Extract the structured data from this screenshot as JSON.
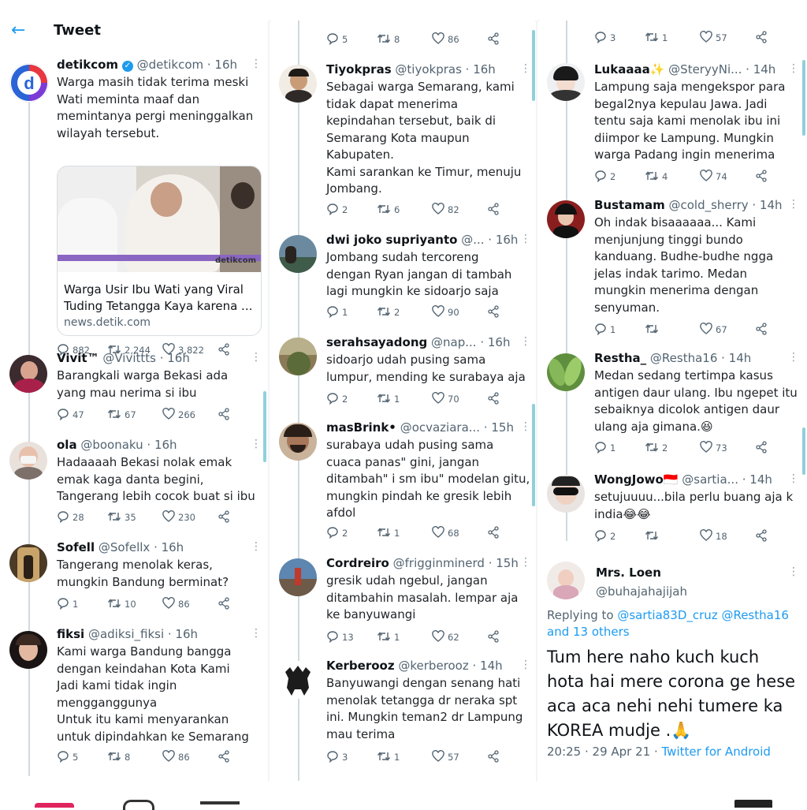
{
  "header": {
    "title": "Tweet"
  },
  "col1": {
    "main_tweet": {
      "name": "detikcom",
      "meta": "@detikcom · 16h",
      "text": "Warga masih tidak terima meski\nWati meminta maaf dan\nmemintanya pergi meninggalkan\nwilayah tersebut.",
      "card_title": "Warga Usir Ibu Wati yang Viral Tuding Tetangga Kaya karena ...",
      "card_domain": "news.detik.com",
      "card_watermark": "detikcom",
      "replies": "882",
      "retweets": "2,244",
      "likes": "3,822"
    },
    "tweets": [
      {
        "name": "Vivit™",
        "meta": "@Vivittts · 16h",
        "text": "Barangkali warga Bekasi ada\nyang mau nerima si ibu",
        "replies": "47",
        "retweets": "67",
        "likes": "266"
      },
      {
        "name": "ola",
        "meta": "@boonaku · 16h",
        "text": "Hadaaaah Bekasi nolak emak\nemak kaga danta begini,\nTangerang lebih cocok buat si ibu",
        "replies": "28",
        "retweets": "35",
        "likes": "230"
      },
      {
        "name": "Sofell",
        "meta": "@Sofellx · 16h",
        "text": "Tangerang menolak keras,\nmungkin Bandung berminat?",
        "replies": "1",
        "retweets": "10",
        "likes": "86"
      },
      {
        "name": "fiksi",
        "meta": "@adiksi_fiksi · 16h",
        "text": "Kami warga Bandung bangga\ndengan keindahan Kota Kami\nJadi kami tidak ingin\nmengganggunya\nUntuk itu kami menyarankan\nuntuk dipindahkan ke Semarang",
        "replies": "5",
        "retweets": "8",
        "likes": "86"
      }
    ]
  },
  "col2": {
    "top_actions": {
      "replies": "5",
      "retweets": "8",
      "likes": "86"
    },
    "tweets": [
      {
        "name": "Tiyokpras",
        "meta": "@tiyokpras · 16h",
        "text": "Sebagai warga Semarang, kami\ntidak dapat menerima\nkepindahan tersebut, baik di\nSemarang Kota maupun\nKabupaten.\nKami sarankan ke Timur, menuju\nJombang.",
        "replies": "2",
        "retweets": "6",
        "likes": "82"
      },
      {
        "name": "dwi joko supriyanto",
        "meta": "@... · 16h",
        "text": "Jombang sudah tercoreng\ndengan Ryan jangan di tambah\nlagi mungkin ke sidoarjo saja",
        "replies": "1",
        "retweets": "2",
        "likes": "90"
      },
      {
        "name": "serahsayadong",
        "meta": "@nap... · 16h",
        "text": "sidoarjo udah pusing sama\nlumpur, mending ke surabaya aja",
        "replies": "2",
        "retweets": "1",
        "likes": "70"
      },
      {
        "name": "masBrink•",
        "meta": "@ocvaziara... · 15h",
        "text": "surabaya udah pusing sama\ncuaca panas\" gini, jangan\nditambah\" i sm ibu\" modelan gitu,\nmungkin pindah ke gresik lebih\nafdol",
        "replies": "2",
        "retweets": "1",
        "likes": "68"
      },
      {
        "name": "Cordreiro",
        "meta": "@frigginminerd · 15h",
        "text": "gresik udah ngebul, jangan\nditambahin masalah. lempar aja\nke banyuwangi",
        "replies": "13",
        "retweets": "1",
        "likes": "62"
      },
      {
        "name": "Kerberooz",
        "meta": "@kerberooz · 14h",
        "text": "Banyuwangi dengan senang hati\nmenolak tetangga dr neraka spt\nini. Mungkin teman2 dr Lampung\nmau terima",
        "replies": "3",
        "retweets": "1",
        "likes": "57"
      }
    ]
  },
  "col3": {
    "top_actions": {
      "replies": "3",
      "retweets": "1",
      "likes": "57"
    },
    "tweets": [
      {
        "name": "Lukaaaa✨",
        "meta": "@SteryyNi... · 14h",
        "text": "Lampung saja mengekspor para\nbegal2nya kepulau Jawa. Jadi\ntentu saja kami menolak ibu ini\ndiimpor ke Lampung. Mungkin\nwarga Padang ingin menerima",
        "replies": "2",
        "retweets": "4",
        "likes": "74"
      },
      {
        "name": "Bustamam",
        "meta": "@cold_sherry · 14h",
        "text": "Oh indak bisaaaaaa... Kami\nmenjunjung tinggi bundo\nkanduang. Budhe-budhe ngga\njelas indak tarimo. Medan\nmungkin menerima dengan\nsenyuman.",
        "replies": "1",
        "retweets": "",
        "likes": "67"
      },
      {
        "name": "Restha_",
        "meta": "@Restha16 · 14h",
        "text": "Medan sedang tertimpa kasus\nantigen daur ulang. Ibu ngepet itu\nsebaiknya dicolok antigen daur\nulang aja gimana.😆",
        "replies": "1",
        "retweets": "2",
        "likes": "73"
      },
      {
        "name": "WongJowo🇮🇩",
        "meta": "@sartia... · 14h",
        "text": "setujuuuu...bila perlu buang aja k\nindia😂😂",
        "replies": "2",
        "retweets": "",
        "likes": "18"
      }
    ],
    "final": {
      "name": "Mrs. Loen",
      "handle": "@buhajahajijah",
      "replying_prefix": "Replying to ",
      "replying_users": "@sartia83D_cruz @Restha16",
      "replying_others": "and 13 others",
      "text": "Tum here naho kuch kuch hota hai mere corona ge hese aca aca nehi nehi tumere ka KOREA mudje .🙏",
      "time": "20:25 · 29 Apr 21 · ",
      "source": "Twitter for Android"
    }
  },
  "colors": {
    "accent": "#1d9bf0",
    "muted": "#536471",
    "thread_line": "#cfd9de"
  }
}
